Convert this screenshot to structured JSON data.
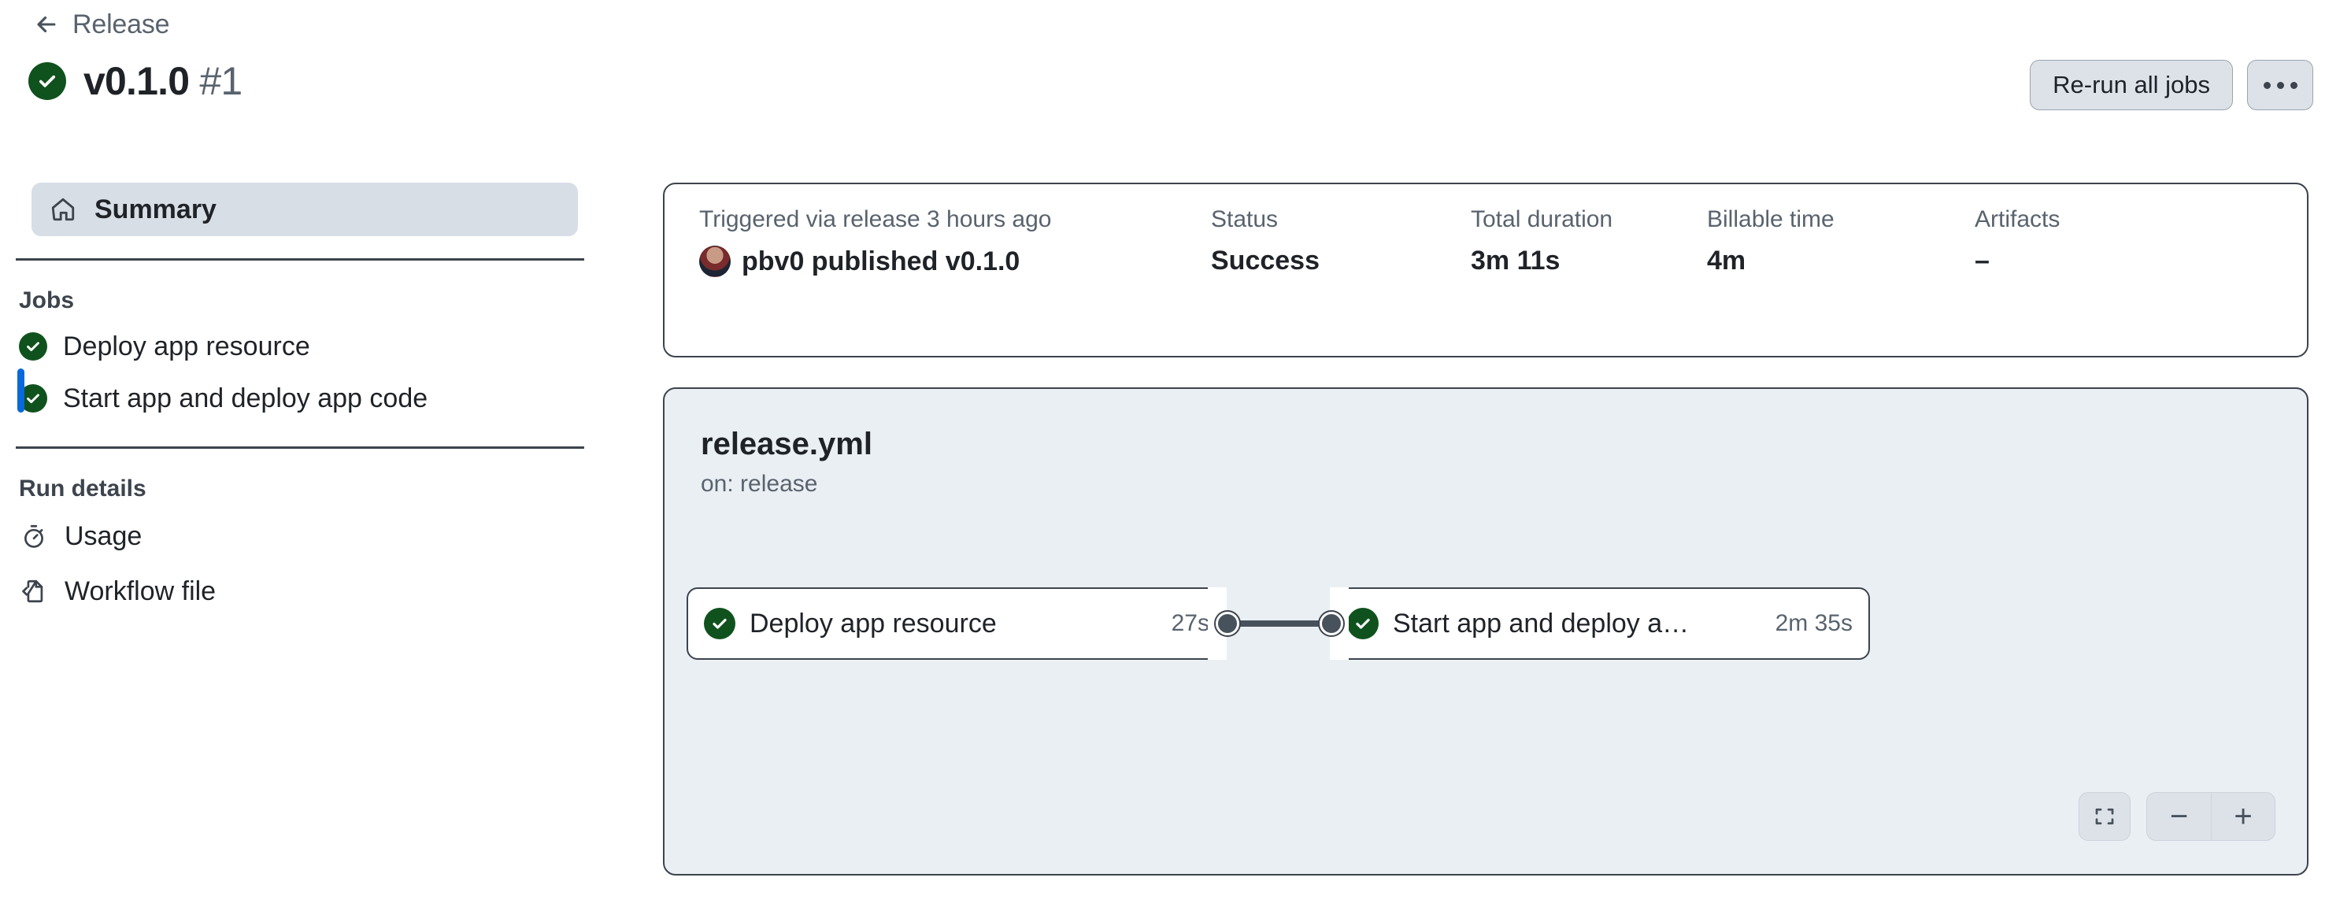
{
  "header": {
    "breadcrumb_label": "Release",
    "back_icon": "arrow-left-icon",
    "run_title": "v0.1.0",
    "run_number": "#1",
    "status_icon": "success-check-icon",
    "rerun_label": "Re-run all jobs",
    "kebab_icon": "kebab-horizontal-icon"
  },
  "sidebar": {
    "summary": {
      "label": "Summary",
      "icon": "home-icon"
    },
    "jobs_section_label": "Jobs",
    "jobs": [
      {
        "label": "Deploy app resource",
        "icon": "success-check-icon"
      },
      {
        "label": "Start app and deploy app code",
        "icon": "success-check-icon"
      }
    ],
    "run_details_label": "Run details",
    "run_details": [
      {
        "label": "Usage",
        "icon": "stopwatch-icon"
      },
      {
        "label": "Workflow file",
        "icon": "file-code-icon"
      }
    ]
  },
  "info": {
    "trigger_label": "Triggered via release 3 hours ago",
    "trigger_value": "pbv0 published v0.1.0",
    "avatar_icon": "user-avatar",
    "status_label": "Status",
    "status_value": "Success",
    "duration_label": "Total duration",
    "duration_value": "3m 11s",
    "billable_label": "Billable time",
    "billable_value": "4m",
    "artifacts_label": "Artifacts",
    "artifacts_value": "–"
  },
  "graph": {
    "workflow_file": "release.yml",
    "workflow_trigger": "on: release",
    "nodes": [
      {
        "label": "Deploy app resource",
        "duration": "27s",
        "icon": "success-check-icon"
      },
      {
        "label": "Start app and deploy a…",
        "duration": "2m 35s",
        "icon": "success-check-icon"
      }
    ],
    "controls": {
      "fit_icon": "fit-to-screen-icon",
      "zoom_out": "−",
      "zoom_in": "+"
    }
  },
  "colors": {
    "success_green": "#10521e",
    "accent_blue": "#0969da",
    "border_dark": "#3d444d",
    "graph_bg": "#eaeff3",
    "muted_text": "#59636e"
  }
}
